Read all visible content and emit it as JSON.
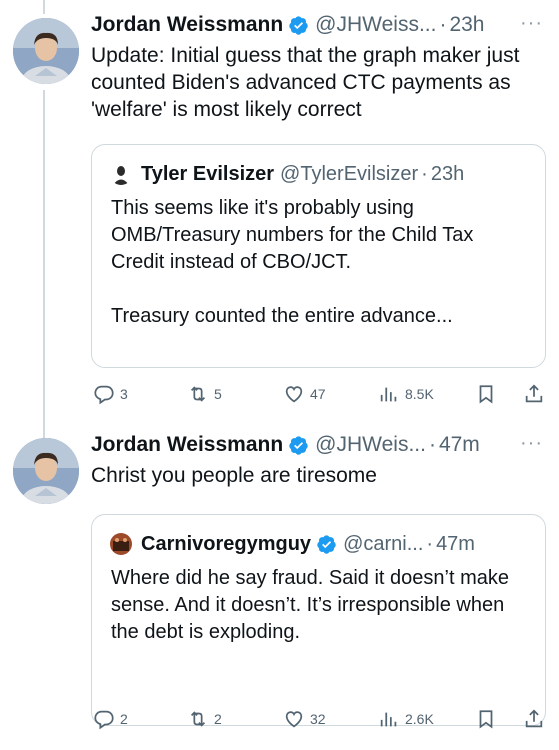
{
  "tweets": [
    {
      "author": "Jordan Weissmann",
      "handle": "@JHWeiss...",
      "separator": "·",
      "time": "23h",
      "more": "···",
      "text": "Update: Initial guess that the graph maker just counted Biden's advanced CTC payments as 'welfare' is most likely correct",
      "quote": {
        "author": "Tyler Evilsizer",
        "handle": "@TylerEvilsizer",
        "separator": "·",
        "time": "23h",
        "text": "This seems like it's probably using OMB/Treasury numbers for the Child Tax Credit instead of CBO/JCT.\n\nTreasury counted the entire advance..."
      },
      "actions": {
        "replies": "3",
        "retweets": "5",
        "likes": "47",
        "views": "8.5K"
      }
    },
    {
      "author": "Jordan Weissmann",
      "handle": "@JHWeis...",
      "separator": "·",
      "time": "47m",
      "more": "···",
      "text": "Christ you people are tiresome",
      "quote": {
        "author": "Carnivoregymguy",
        "handle": "@carni...",
        "separator": "·",
        "time": "47m",
        "text": "Where did he say fraud. Said it doesn’t make sense. And it doesn’t. It’s irresponsible when the debt is exploding."
      },
      "actions": {
        "replies": "2",
        "retweets": "2",
        "likes": "32",
        "views": "2.6K"
      }
    }
  ],
  "colors": {
    "verified": "#1d9bf0",
    "secondary_text": "#536471",
    "border": "#cfd9de"
  }
}
